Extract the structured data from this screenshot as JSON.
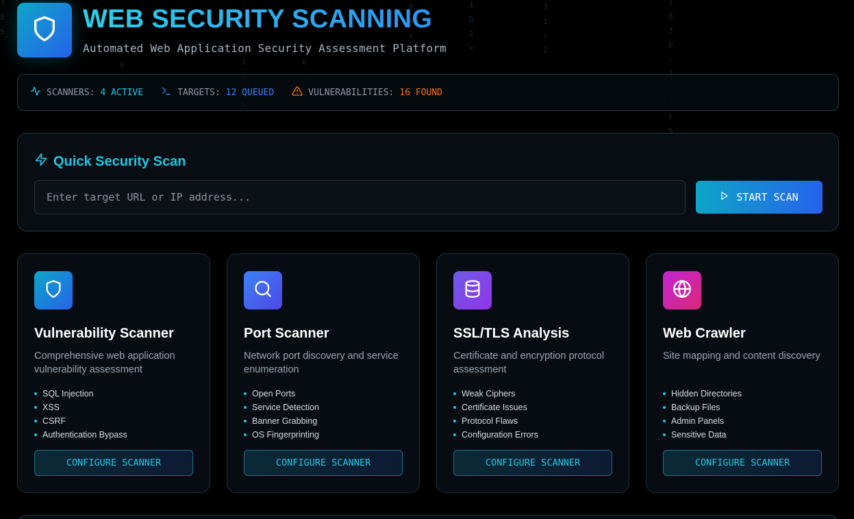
{
  "header": {
    "title": "WEB SECURITY SCANNING",
    "subtitle": "Automated Web Application Security Assessment Platform",
    "logo_icon": "shield-icon"
  },
  "status": [
    {
      "icon": "activity-icon",
      "label": "SCANNERS:",
      "value": "4 ACTIVE",
      "color": "#22c5e3"
    },
    {
      "icon": "terminal-icon",
      "label": "TARGETS:",
      "value": "12 QUEUED",
      "color": "#3b82f6"
    },
    {
      "icon": "warning-icon",
      "label": "VULNERABILITIES:",
      "value": "16 FOUND",
      "color": "#f97316"
    }
  ],
  "quick_scan": {
    "title": "Quick Security Scan",
    "placeholder": "Enter target URL or IP address...",
    "button_label": "START SCAN"
  },
  "cards": [
    {
      "icon": "shield-icon",
      "title": "Vulnerability Scanner",
      "description": "Comprehensive web application vulnerability assessment",
      "items": [
        "SQL Injection",
        "XSS",
        "CSRF",
        "Authentication Bypass"
      ],
      "button": "CONFIGURE SCANNER",
      "gradient": [
        "#0ea5c6",
        "#2563eb"
      ]
    },
    {
      "icon": "search-icon",
      "title": "Port Scanner",
      "description": "Network port discovery and service enumeration",
      "items": [
        "Open Ports",
        "Service Detection",
        "Banner Grabbing",
        "OS Fingerprinting"
      ],
      "button": "CONFIGURE SCANNER",
      "gradient": [
        "#3b82f6",
        "#4f46e5"
      ]
    },
    {
      "icon": "database-icon",
      "title": "SSL/TLS Analysis",
      "description": "Certificate and encryption protocol assessment",
      "items": [
        "Weak Ciphers",
        "Certificate Issues",
        "Protocol Flaws",
        "Configuration Errors"
      ],
      "button": "CONFIGURE SCANNER",
      "gradient": [
        "#6d5ce7",
        "#9333ea"
      ]
    },
    {
      "icon": "globe-icon",
      "title": "Web Crawler",
      "description": "Site mapping and content discovery",
      "items": [
        "Hidden Directories",
        "Backup Files",
        "Admin Panels",
        "Sensitive Data"
      ],
      "button": "CONFIGURE SCANNER",
      "gradient": [
        "#c026d3",
        "#db2777"
      ]
    }
  ]
}
